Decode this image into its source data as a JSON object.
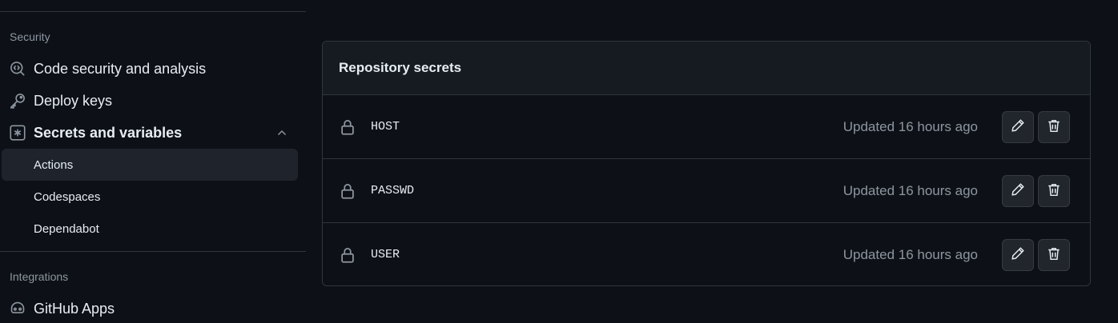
{
  "sidebar": {
    "security_heading": "Security",
    "items": [
      {
        "label": "Code security and analysis",
        "icon": "codescan-icon"
      },
      {
        "label": "Deploy keys",
        "icon": "key-icon"
      },
      {
        "label": "Secrets and variables",
        "icon": "asterisk-box-icon",
        "expanded": true
      }
    ],
    "subitems": [
      {
        "label": "Actions",
        "active": true
      },
      {
        "label": "Codespaces",
        "active": false
      },
      {
        "label": "Dependabot",
        "active": false
      }
    ],
    "integrations_heading": "Integrations",
    "integrations": [
      {
        "label": "GitHub Apps",
        "icon": "github-app-icon"
      }
    ]
  },
  "secrets": {
    "title": "Repository secrets",
    "rows": [
      {
        "name": "HOST",
        "updated": "Updated 16 hours ago"
      },
      {
        "name": "PASSWD",
        "updated": "Updated 16 hours ago"
      },
      {
        "name": "USER",
        "updated": "Updated 16 hours ago"
      }
    ]
  },
  "colors": {
    "background": "#0d1117",
    "panel_header": "#161b22",
    "border": "#30363d",
    "muted_text": "#8d96a0",
    "active_item": "#1f242c"
  }
}
